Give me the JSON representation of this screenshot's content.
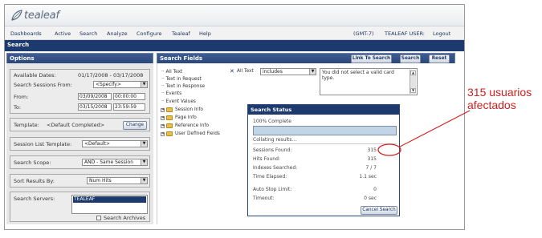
{
  "brand": {
    "name": "tealeaf"
  },
  "menu": {
    "items": [
      "Dashboards",
      "Active",
      "Search",
      "Analyze",
      "Configure",
      "Tealeaf",
      "Help"
    ],
    "timezone": "(GMT-7)",
    "user_label": "TEALEAF USER:",
    "logout": "Logout"
  },
  "section_title": "Search",
  "options": {
    "title": "Options",
    "available_label": "Available Dates:",
    "available_value": "01/17/2008 - 03/17/2008",
    "sessions_from_label": "Search Sessions From:",
    "sessions_from_value": "<Specify>",
    "from_label": "From:",
    "from_date": "03/09/2008",
    "from_time": "00:00:00",
    "to_label": "To:",
    "to_date": "03/15/2008",
    "to_time": "23:59:59",
    "template_label": "Template:",
    "template_value": "<Default Completed>",
    "change_button": "Change",
    "session_list_label": "Session List Template:",
    "session_list_value": "<Default>",
    "scope_label": "Search Scope:",
    "scope_value": "AND - Same Session",
    "sort_label": "Sort Results By:",
    "sort_value": "Num Hits",
    "servers_label": "Search Servers:",
    "servers_selected": "TEALEAF",
    "archives_label": "Search Archives"
  },
  "search_fields": {
    "title": "Search Fields",
    "link_button": "Link To Search",
    "search_button": "Search",
    "reset_button": "Reset",
    "tree": [
      "All Text",
      "Text in Request",
      "Text in Response",
      "Events",
      "Event Values"
    ],
    "folders": [
      "Session Info",
      "Page Info",
      "Reference Info",
      "User Defined Fields"
    ],
    "criteria_field": "All Text",
    "criteria_operator": "includes",
    "message": "You did not select a valid card type."
  },
  "status": {
    "title": "Search Status",
    "complete": "100% Complete",
    "collating": "Collating results...",
    "rows": [
      {
        "label": "Sessions Found:",
        "value": "315"
      },
      {
        "label": "Hits Found:",
        "value": "315"
      },
      {
        "label": "Indexes Searched:",
        "value": "7  /  7"
      },
      {
        "label": "Time Elapsed:",
        "value": "1.1 sec"
      },
      {
        "label": "Auto Stop Limit:",
        "value": "0"
      },
      {
        "label": "Timeout:",
        "value": "0 sec"
      }
    ],
    "progress": 1.0,
    "cancel_button": "Cancel Search"
  },
  "annotation": {
    "line1": "315 usuarios",
    "line2": "afectados",
    "color": "#d21e1e"
  },
  "colors": {
    "accent": "#1d3a6e",
    "panel_header": "#2a477b",
    "annotation": "#d21e1e"
  }
}
